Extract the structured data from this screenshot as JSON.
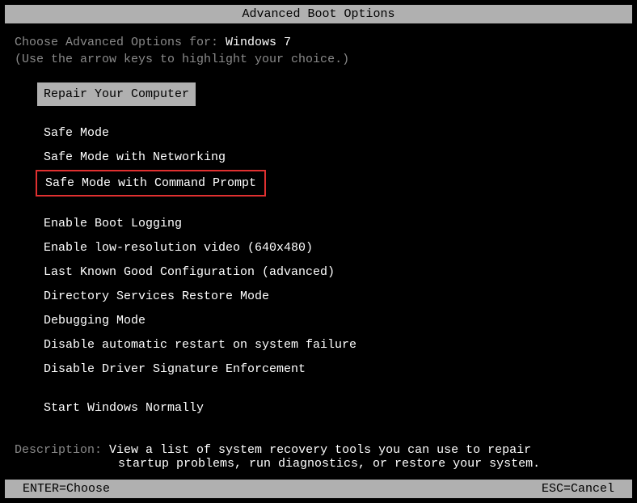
{
  "title": "Advanced Boot Options",
  "prompt": {
    "prefix": "Choose Advanced Options for: ",
    "os": "Windows 7"
  },
  "instruction": "(Use the arrow keys to highlight your choice.)",
  "selected_item": "Repair Your Computer",
  "group1": {
    "item0": "Safe Mode",
    "item1": "Safe Mode with Networking",
    "item2": "Safe Mode with Command Prompt"
  },
  "group2": {
    "item0": "Enable Boot Logging",
    "item1": "Enable low-resolution video (640x480)",
    "item2": "Last Known Good Configuration (advanced)",
    "item3": "Directory Services Restore Mode",
    "item4": "Debugging Mode",
    "item5": "Disable automatic restart on system failure",
    "item6": "Disable Driver Signature Enforcement"
  },
  "group3": {
    "item0": "Start Windows Normally"
  },
  "description": {
    "label": "Description: ",
    "line1": "View a list of system recovery tools you can use to repair",
    "line2": "startup problems, run diagnostics, or restore your system."
  },
  "footer": {
    "left": "ENTER=Choose",
    "right": "ESC=Cancel"
  }
}
